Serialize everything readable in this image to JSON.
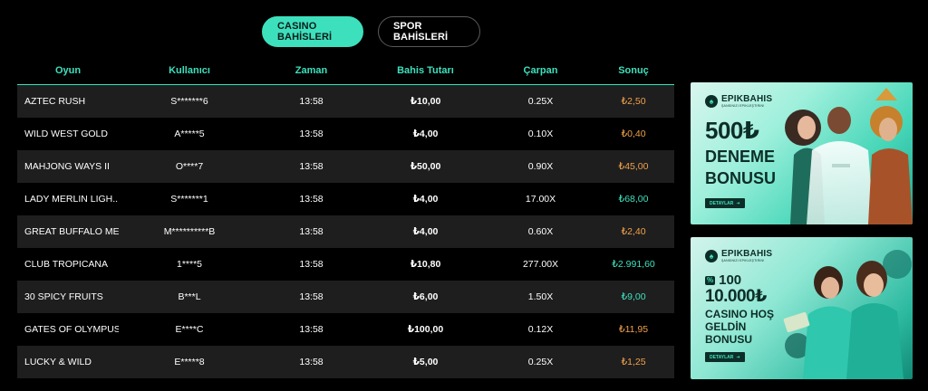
{
  "tabs": [
    {
      "label": "CASINO BAHİSLERİ",
      "active": true
    },
    {
      "label": "SPOR BAHİSLERİ",
      "active": false
    }
  ],
  "table": {
    "headers": [
      "Oyun",
      "Kullanıcı",
      "Zaman",
      "Bahis Tutarı",
      "Çarpan",
      "Sonuç"
    ],
    "rows": [
      {
        "game": "AZTEC RUSH",
        "user": "S*******6",
        "time": "13:58",
        "amount": "₺10,00",
        "mult": "0.25X",
        "result": "₺2,50",
        "status": "loss"
      },
      {
        "game": "WILD WEST GOLD",
        "user": "A*****5",
        "time": "13:58",
        "amount": "₺4,00",
        "mult": "0.10X",
        "result": "₺0,40",
        "status": "loss"
      },
      {
        "game": "MAHJONG WAYS II",
        "user": "O****7",
        "time": "13:58",
        "amount": "₺50,00",
        "mult": "0.90X",
        "result": "₺45,00",
        "status": "loss"
      },
      {
        "game": "LADY MERLIN LIGH...",
        "user": "S*******1",
        "time": "13:58",
        "amount": "₺4,00",
        "mult": "17.00X",
        "result": "₺68,00",
        "status": "win"
      },
      {
        "game": "GREAT BUFFALO ME...",
        "user": "M**********B",
        "time": "13:58",
        "amount": "₺4,00",
        "mult": "0.60X",
        "result": "₺2,40",
        "status": "loss"
      },
      {
        "game": "CLUB TROPICANA",
        "user": "1****5",
        "time": "13:58",
        "amount": "₺10,80",
        "mult": "277.00X",
        "result": "₺2.991,60",
        "status": "win"
      },
      {
        "game": "30 SPICY FRUITS",
        "user": "B***L",
        "time": "13:58",
        "amount": "₺6,00",
        "mult": "1.50X",
        "result": "₺9,00",
        "status": "win"
      },
      {
        "game": "GATES OF OLYMPUS",
        "user": "E****C",
        "time": "13:58",
        "amount": "₺100,00",
        "mult": "0.12X",
        "result": "₺11,95",
        "status": "loss"
      },
      {
        "game": "LUCKY & WILD",
        "user": "E*****8",
        "time": "13:58",
        "amount": "₺5,00",
        "mult": "0.25X",
        "result": "₺1,25",
        "status": "loss"
      }
    ]
  },
  "banners": [
    {
      "brand": "EPIKBAHIS",
      "tagline": "ŞANSINIZI EPIKLEŞTIRIN!",
      "headline": "500₺",
      "sub": "DENEME BONUSU",
      "cta": "DETAYLAR"
    },
    {
      "brand": "EPIKBAHIS",
      "tagline": "ŞANSINIZI EPIKLEŞTIRIN!",
      "pre": "100",
      "pre_badge": "%",
      "headline": "10.000₺",
      "sub": "CASINO HOŞ GELDİN BONUSU",
      "cta": "DETAYLAR"
    }
  ],
  "colors": {
    "accent": "#3de0bd",
    "loss": "#f0a04b",
    "win": "#3de0bd",
    "row_alt": "#1e1e1e",
    "background": "#000000"
  },
  "icons": {
    "brand": "spade-icon",
    "cta_arrow": "arrow-right-icon"
  }
}
